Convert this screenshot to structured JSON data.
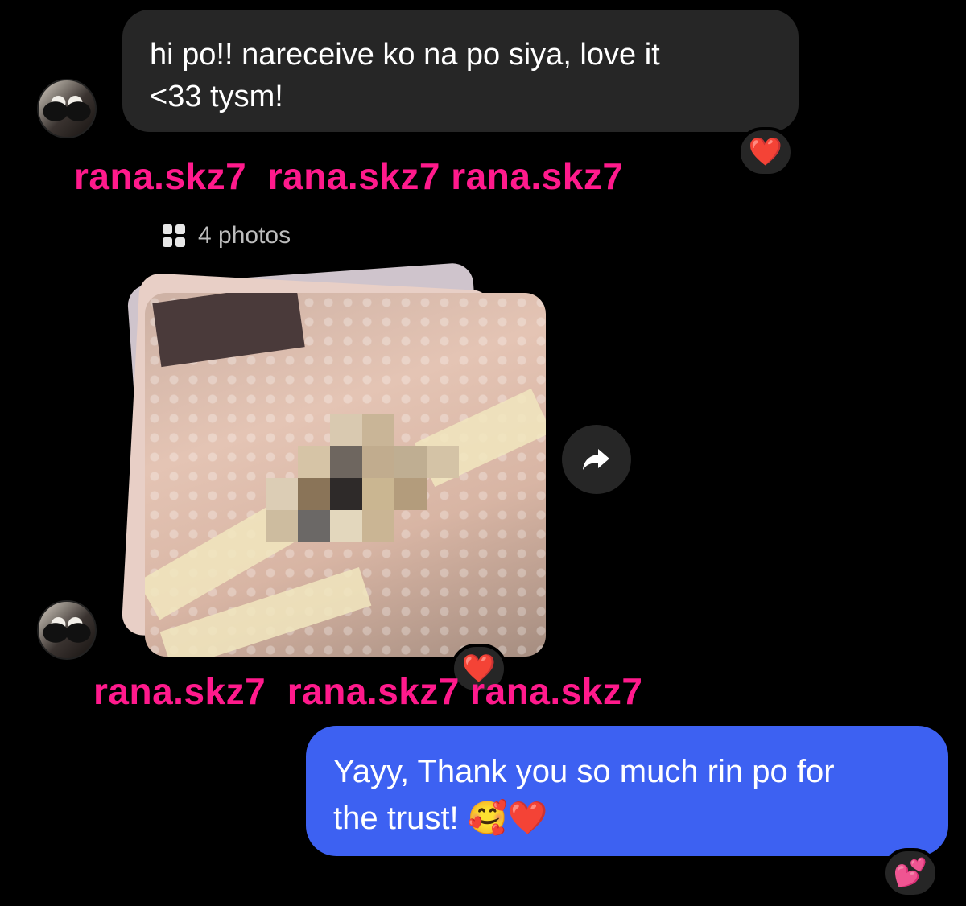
{
  "messages": [
    {
      "sender": "rana.skz7",
      "text": "hi po!! nareceive ko na po siya, love it\n<33 tysm!",
      "reaction": "❤️"
    },
    {
      "sender": "rana.skz7",
      "attachment_label": "4 photos",
      "reaction": "❤️"
    },
    {
      "sender": "me",
      "text_line1": "Yayy, Thank you so much rin po for",
      "text_line2": "the trust! 🥰❤️",
      "reaction": "💕"
    }
  ],
  "watermark": "rana.skz7  rana.skz7 rana.skz7",
  "icons": {
    "grid": "grid-icon",
    "share": "share-icon"
  },
  "colors": {
    "incoming_bubble": "#262626",
    "outgoing_bubble": "#3d61f2",
    "watermark": "#ff1a8c"
  }
}
